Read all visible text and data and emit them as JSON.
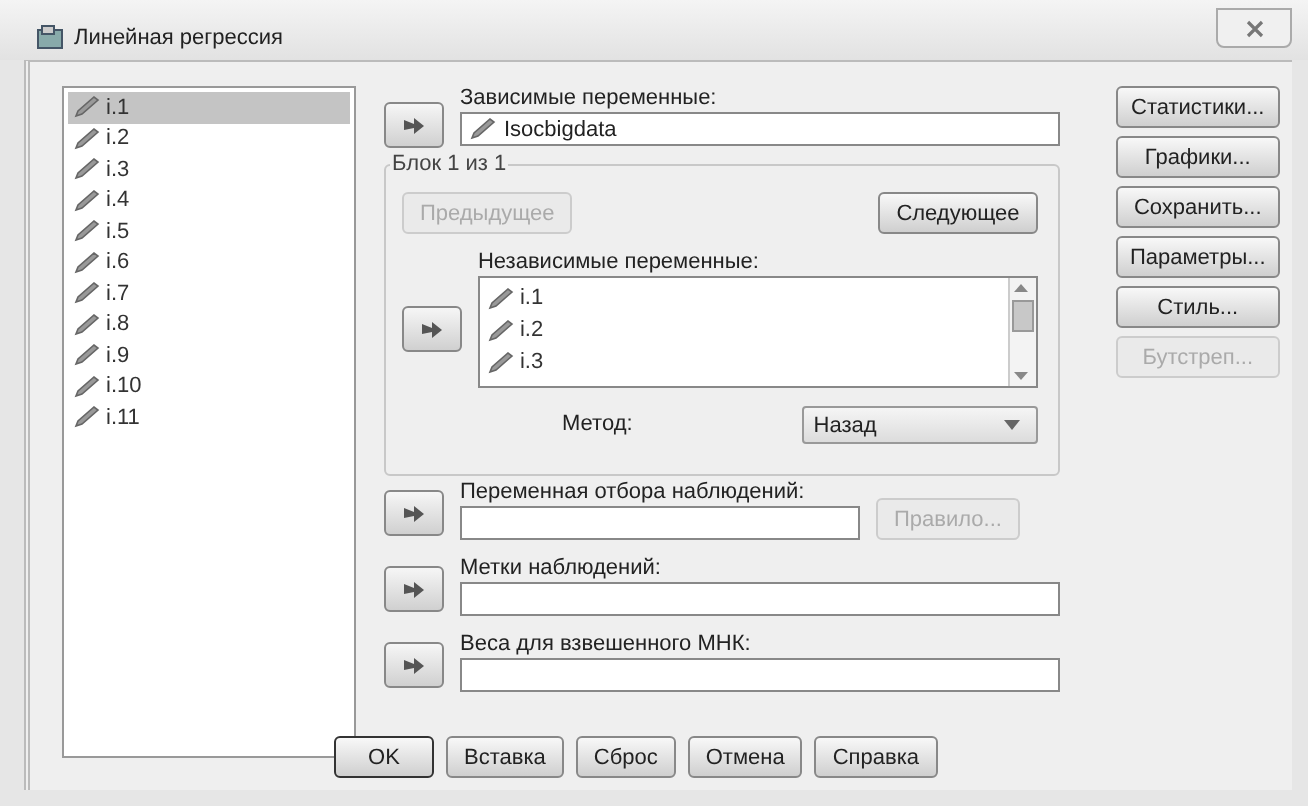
{
  "window": {
    "title": "Линейная регрессия"
  },
  "variables": [
    {
      "name": "i.1",
      "selected": true
    },
    {
      "name": "i.2",
      "selected": false
    },
    {
      "name": "i.3",
      "selected": false
    },
    {
      "name": "i.4",
      "selected": false
    },
    {
      "name": "i.5",
      "selected": false
    },
    {
      "name": "i.6",
      "selected": false
    },
    {
      "name": "i.7",
      "selected": false
    },
    {
      "name": "i.8",
      "selected": false
    },
    {
      "name": "i.9",
      "selected": false
    },
    {
      "name": "i.10",
      "selected": false
    },
    {
      "name": "i.11",
      "selected": false
    }
  ],
  "dependent": {
    "label": "Зависимые переменные:",
    "value": "Isocbigdata"
  },
  "block": {
    "title": "Блок 1 из 1",
    "previous": {
      "label": "Предыдущее",
      "disabled": true
    },
    "next": {
      "label": "Следующее",
      "disabled": false
    },
    "independent": {
      "label": "Независимые переменные:",
      "items": [
        "i.1",
        "i.2",
        "i.3"
      ]
    },
    "method": {
      "label": "Метод:",
      "value": "Назад"
    }
  },
  "selection": {
    "label": "Переменная отбора наблюдений:",
    "rule": {
      "label": "Правило...",
      "disabled": true
    }
  },
  "case_labels": {
    "label": "Метки наблюдений:"
  },
  "weights": {
    "label": "Веса для взвешенного МНК:"
  },
  "side_buttons": [
    {
      "label": "Статистики...",
      "disabled": false
    },
    {
      "label": "Графики...",
      "disabled": false
    },
    {
      "label": "Сохранить...",
      "disabled": false
    },
    {
      "label": "Параметры...",
      "disabled": false
    },
    {
      "label": "Стиль...",
      "disabled": false
    },
    {
      "label": "Бутстреп...",
      "disabled": true
    }
  ],
  "bottom_buttons": [
    {
      "label": "OK",
      "default": true
    },
    {
      "label": "Вставка",
      "default": false
    },
    {
      "label": "Сброс",
      "default": false
    },
    {
      "label": "Отмена",
      "default": false
    },
    {
      "label": "Справка",
      "default": false
    }
  ]
}
